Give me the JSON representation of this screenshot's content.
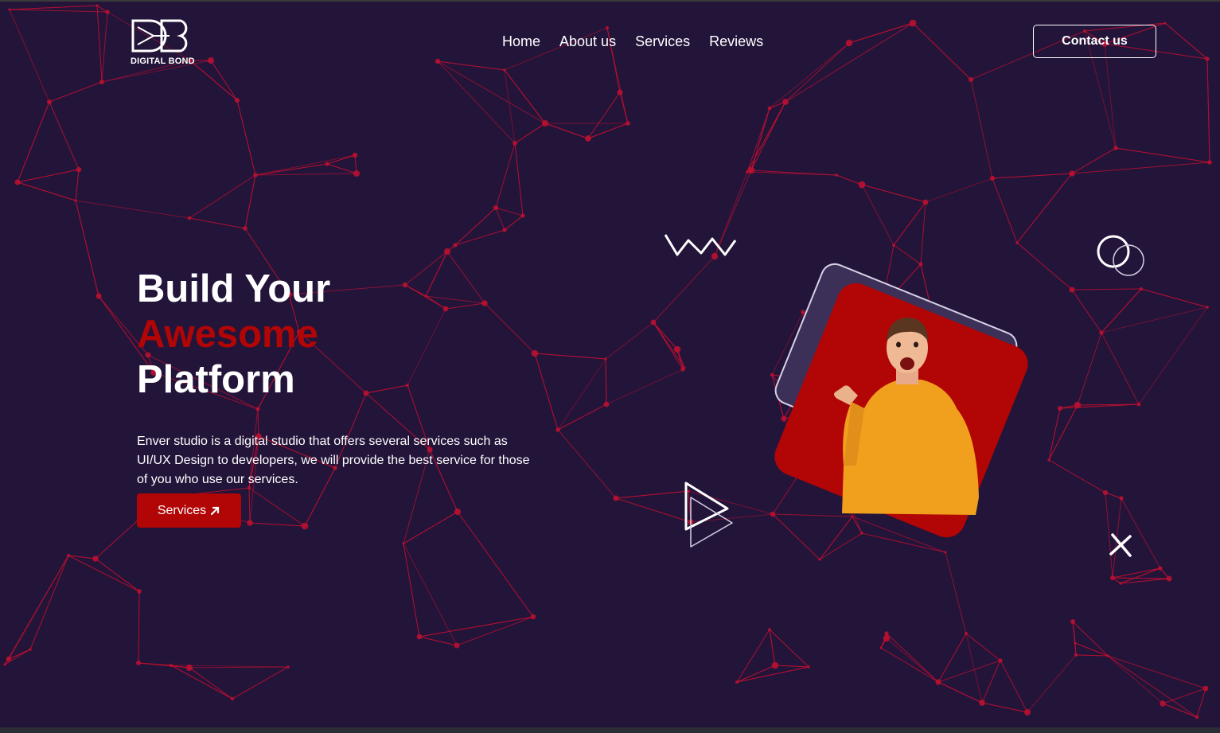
{
  "brand": {
    "logo_mark": "DB",
    "name": "DIGITAL BOND"
  },
  "nav": {
    "items": [
      "Home",
      "About us",
      "Services",
      "Reviews"
    ]
  },
  "header": {
    "contact_label": "Contact us"
  },
  "hero": {
    "headline_line1": "Build Your",
    "headline_line2": "Awesome",
    "headline_line3": "Platform",
    "description": "Enver studio is a digital studio that offers several services such as UI/UX Design to developers, we will provide the best service for those of you who use our services.",
    "cta_label": "Services",
    "cta_icon": "arrow-up-right-icon"
  },
  "colors": {
    "background": "#23143a",
    "accent": "#b20505",
    "network": "#c01030",
    "person_shirt": "#f0a01c"
  }
}
